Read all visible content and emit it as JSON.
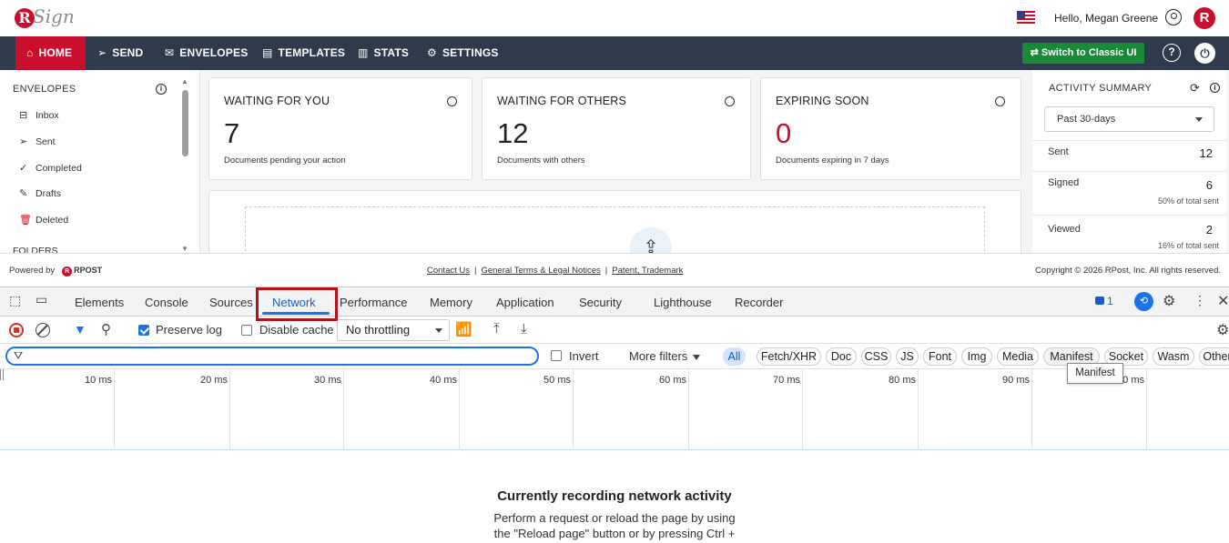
{
  "header": {
    "logo_text": "Sign",
    "logo_letter": "R",
    "greeting": "Hello, Megan Greene",
    "avatar_letter": "R"
  },
  "nav": {
    "items": [
      {
        "label": "HOME",
        "icon": "home-icon"
      },
      {
        "label": "SEND",
        "icon": "send-icon"
      },
      {
        "label": "ENVELOPES",
        "icon": "envelope-icon"
      },
      {
        "label": "TEMPLATES",
        "icon": "template-icon"
      },
      {
        "label": "STATS",
        "icon": "stats-icon"
      },
      {
        "label": "SETTINGS",
        "icon": "gear-icon"
      }
    ],
    "classic_button": "Switch to Classic UI",
    "colors": {
      "nav_bg": "#2f3b4c",
      "active": "#c8102e",
      "classic_btn": "#1a8a3a"
    }
  },
  "sidebar": {
    "title": "ENVELOPES",
    "items": [
      {
        "label": "Inbox",
        "icon": "inbox-icon"
      },
      {
        "label": "Sent",
        "icon": "send-icon"
      },
      {
        "label": "Completed",
        "icon": "check-circle-icon"
      },
      {
        "label": "Drafts",
        "icon": "edit-icon"
      },
      {
        "label": "Deleted",
        "icon": "trash-icon"
      }
    ],
    "folders_title": "FOLDERS"
  },
  "cards": [
    {
      "title": "WAITING FOR YOU",
      "value": "7",
      "subtitle": "Documents pending your action",
      "value_color": "#222222"
    },
    {
      "title": "WAITING FOR OTHERS",
      "value": "12",
      "subtitle": "Documents with others",
      "value_color": "#222222"
    },
    {
      "title": "EXPIRING SOON",
      "value": "0",
      "subtitle": "Documents expiring in 7 days",
      "value_color": "#c8102e"
    }
  ],
  "activity": {
    "title": "ACTIVITY SUMMARY",
    "period": "Past 30-days",
    "rows": [
      {
        "label": "Sent",
        "value": "12",
        "pct": ""
      },
      {
        "label": "Signed",
        "value": "6",
        "pct": "50% of total sent"
      },
      {
        "label": "Viewed",
        "value": "2",
        "pct": "16% of total sent"
      }
    ]
  },
  "footer": {
    "powered_by": "Powered by",
    "rpost": "RPOST",
    "links": [
      "Contact Us",
      "General Terms & Legal Notices",
      "Patent, Trademark"
    ],
    "copyright": "Copyright © 2026 RPost, Inc. All rights reserved."
  },
  "devtools": {
    "tabs": [
      "Elements",
      "Console",
      "Sources",
      "Network",
      "Performance",
      "Memory",
      "Application",
      "Security",
      "Lighthouse",
      "Recorder"
    ],
    "message_count": "1",
    "preserve_log": "Preserve log",
    "disable_cache": "Disable cache",
    "throttling": "No throttling",
    "invert": "Invert",
    "more_filters": "More filters",
    "chips": [
      "All",
      "Fetch/XHR",
      "Doc",
      "CSS",
      "JS",
      "Font",
      "Img",
      "Media",
      "Manifest",
      "Socket",
      "Wasm",
      "Other"
    ],
    "tooltip": "Manifest",
    "ticks": [
      "10 ms",
      "20 ms",
      "30 ms",
      "40 ms",
      "50 ms",
      "60 ms",
      "70 ms",
      "80 ms",
      "90 ms",
      "00 ms"
    ],
    "empty_title": "Currently recording network activity",
    "empty_line1": "Perform a request or reload the page by using",
    "empty_line2": "the \"Reload page\" button or by pressing Ctrl +"
  }
}
